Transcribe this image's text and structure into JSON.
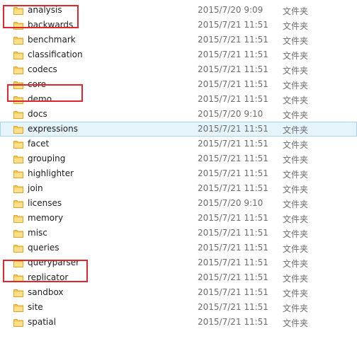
{
  "rows": [
    {
      "name": "analysis",
      "date": "2015/7/20 9:09",
      "type": "文件夹"
    },
    {
      "name": "backwards",
      "date": "2015/7/21 11:51",
      "type": "文件夹"
    },
    {
      "name": "benchmark",
      "date": "2015/7/21 11:51",
      "type": "文件夹"
    },
    {
      "name": "classification",
      "date": "2015/7/21 11:51",
      "type": "文件夹"
    },
    {
      "name": "codecs",
      "date": "2015/7/21 11:51",
      "type": "文件夹"
    },
    {
      "name": "core",
      "date": "2015/7/21 11:51",
      "type": "文件夹"
    },
    {
      "name": "demo",
      "date": "2015/7/21 11:51",
      "type": "文件夹"
    },
    {
      "name": "docs",
      "date": "2015/7/20 9:10",
      "type": "文件夹"
    },
    {
      "name": "expressions",
      "date": "2015/7/21 11:51",
      "type": "文件夹"
    },
    {
      "name": "facet",
      "date": "2015/7/21 11:51",
      "type": "文件夹"
    },
    {
      "name": "grouping",
      "date": "2015/7/21 11:51",
      "type": "文件夹"
    },
    {
      "name": "highlighter",
      "date": "2015/7/21 11:51",
      "type": "文件夹"
    },
    {
      "name": "join",
      "date": "2015/7/21 11:51",
      "type": "文件夹"
    },
    {
      "name": "licenses",
      "date": "2015/7/20 9:10",
      "type": "文件夹"
    },
    {
      "name": "memory",
      "date": "2015/7/21 11:51",
      "type": "文件夹"
    },
    {
      "name": "misc",
      "date": "2015/7/21 11:51",
      "type": "文件夹"
    },
    {
      "name": "queries",
      "date": "2015/7/21 11:51",
      "type": "文件夹"
    },
    {
      "name": "queryparser",
      "date": "2015/7/21 11:51",
      "type": "文件夹"
    },
    {
      "name": "replicator",
      "date": "2015/7/21 11:51",
      "type": "文件夹"
    },
    {
      "name": "sandbox",
      "date": "2015/7/21 11:51",
      "type": "文件夹"
    },
    {
      "name": "site",
      "date": "2015/7/21 11:51",
      "type": "文件夹"
    },
    {
      "name": "spatial",
      "date": "2015/7/21 11:51",
      "type": "文件夹"
    }
  ],
  "selected_row": "expressions",
  "highlighted_rows": [
    "analysis",
    "core",
    "queryparser"
  ],
  "icon": "folder-icon",
  "colors": {
    "folder": "#f4c84a",
    "folder_dark": "#d9a52a",
    "highlight_border": "#e0262c",
    "selection_bg": "#e5f3fb",
    "selection_border": "#a6d4f2"
  }
}
